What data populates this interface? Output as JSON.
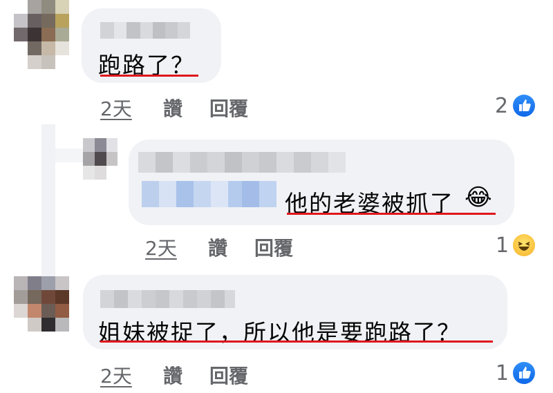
{
  "comments": [
    {
      "text": "跑路了？",
      "time": "2天",
      "like": "讚",
      "reply": "回覆",
      "reactions": "2",
      "reaction_icon": "thumbs-up-icon"
    },
    {
      "text": "他的老婆被抓了",
      "emoji": "😂",
      "time": "2天",
      "like": "讚",
      "reply": "回覆",
      "reactions": "1",
      "reaction_icon": "haha-icon"
    },
    {
      "text": "姐妹被捉了，所以他是要跑路了？",
      "time": "2天",
      "like": "讚",
      "reply": "回覆",
      "reactions": "1",
      "reaction_icon": "thumbs-up-icon"
    }
  ],
  "colors": {
    "bubble": "#f0f2f5",
    "underline": "#e0151c",
    "meta": "#65676b",
    "like_blue": "#1877f2"
  }
}
